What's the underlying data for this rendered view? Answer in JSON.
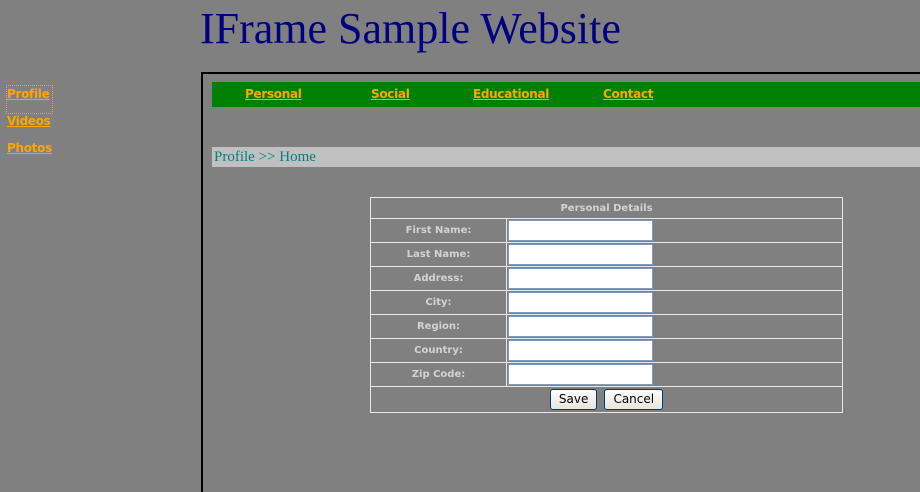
{
  "site": {
    "title": "IFrame Sample Website"
  },
  "left_nav": {
    "items": [
      {
        "label": "Profile"
      },
      {
        "label": "Videos"
      },
      {
        "label": "Photos"
      }
    ]
  },
  "top_nav": {
    "items": [
      {
        "label": "Personal"
      },
      {
        "label": "Social"
      },
      {
        "label": "Educational"
      },
      {
        "label": "Contact"
      }
    ]
  },
  "breadcrumb": "Profile >> Home",
  "form": {
    "header": "Personal Details",
    "fields": [
      {
        "label": "First Name:",
        "value": ""
      },
      {
        "label": "Last Name:",
        "value": ""
      },
      {
        "label": "Address:",
        "value": ""
      },
      {
        "label": "City:",
        "value": ""
      },
      {
        "label": "Region:",
        "value": ""
      },
      {
        "label": "Country:",
        "value": ""
      },
      {
        "label": "Zip Code:",
        "value": ""
      }
    ],
    "save_label": "Save",
    "cancel_label": "Cancel"
  },
  "colors": {
    "page_background": "#808080",
    "title": "#000080",
    "link": "#FFA500",
    "nav_bar": "#008000",
    "breadcrumb_background": "#C0C0C0",
    "breadcrumb_text": "#008080"
  }
}
